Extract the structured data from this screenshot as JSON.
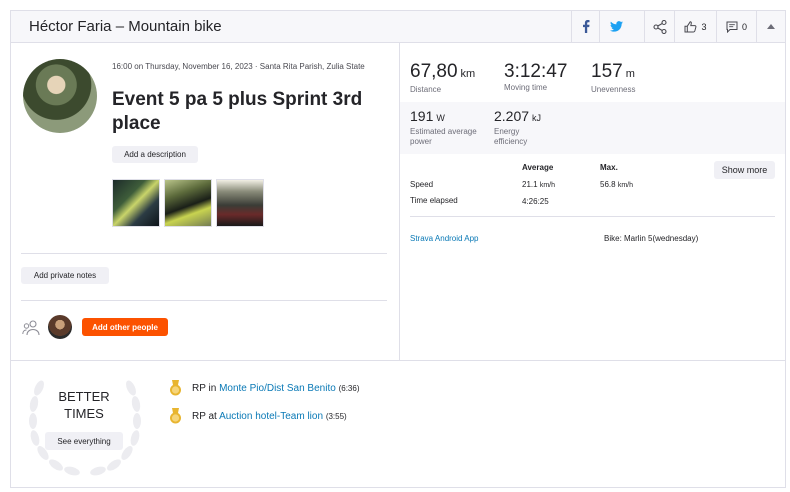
{
  "header": {
    "title": "Héctor Faria – Mountain bike",
    "kudos_count": "3",
    "comments_count": "0"
  },
  "activity": {
    "meta": "16:00 on Thursday, November 16, 2023 · Santa Rita Parish, Zulia State",
    "title": "Event 5 pa 5 plus Sprint 3rd place",
    "add_description": "Add a description",
    "add_private_notes": "Add private notes",
    "add_other_people": "Add other people"
  },
  "stats": {
    "distance": {
      "value": "67,80",
      "unit": "km",
      "label": "Distance"
    },
    "moving_time": {
      "value": "3:12:47",
      "label": "Moving time"
    },
    "unevenness": {
      "value": "157",
      "unit": "m",
      "label": "Unevenness"
    },
    "power": {
      "value": "191",
      "unit": "W",
      "label": "Estimated average power"
    },
    "energy": {
      "value": "2.207",
      "unit": "kJ",
      "label": "Energy efficiency"
    }
  },
  "details": {
    "col_average": "Average",
    "col_max": "Max.",
    "show_more": "Show more",
    "speed_label": "Speed",
    "speed_avg": "21.1",
    "speed_max": "56.8",
    "speed_unit": "km/h",
    "time_label": "Time elapsed",
    "time_value": "4:26:25",
    "device": "Strava Android App",
    "bike": "Bike: Marlin 5(wednesday)"
  },
  "better_times": {
    "title": "BETTER TIMES",
    "see_everything": "See everything",
    "records": [
      {
        "prefix": "RP in",
        "segment": "Monte Pio/Dist San Benito",
        "time": "(6:36)"
      },
      {
        "prefix": "RP at",
        "segment": "Auction hotel-Team lion",
        "time": "(3:55)"
      }
    ]
  },
  "colors": {
    "accent": "#fc5200",
    "link": "#0a79b6",
    "facebook": "#3b5998",
    "twitter": "#1da1f2",
    "medal": "#e8b530"
  },
  "icons": [
    "facebook-icon",
    "twitter-icon",
    "share-icon",
    "kudos-icon",
    "comment-icon",
    "collapse-icon",
    "people-icon",
    "medal-icon",
    "laurel-icon"
  ]
}
